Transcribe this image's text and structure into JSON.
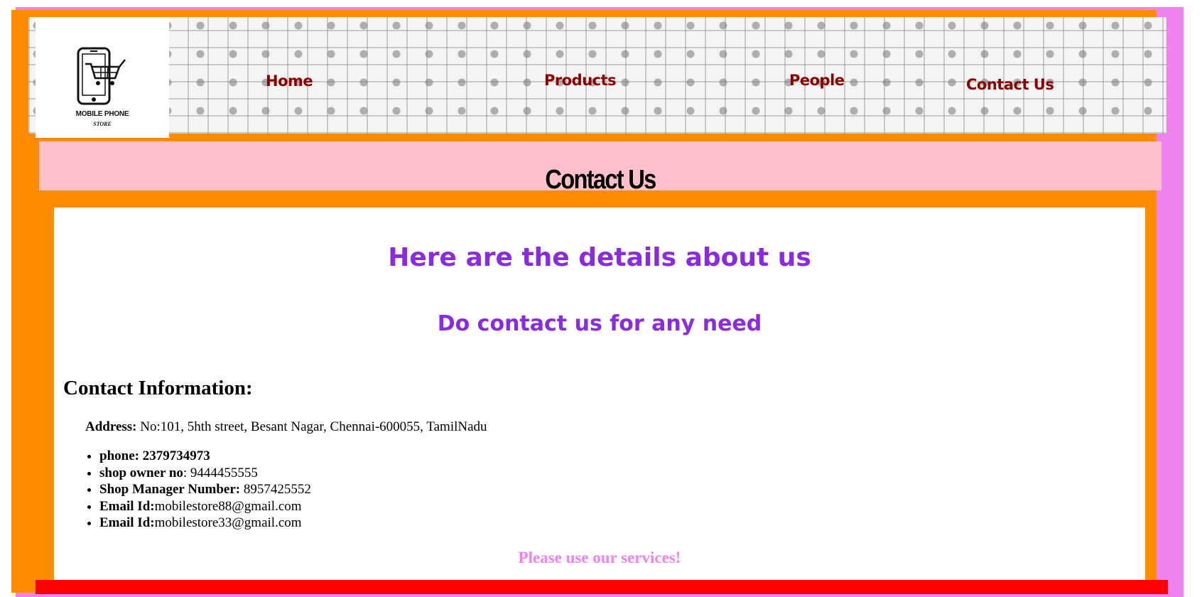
{
  "logo": {
    "line1": "MOBILE PHONE",
    "line2": "STORE"
  },
  "nav": {
    "home": "Home",
    "products": "Products",
    "people": "People",
    "contact": "Contact Us"
  },
  "title_bar": {
    "title": "Contact Us"
  },
  "main": {
    "heading": "Here are the details about us",
    "subheading": "Do contact us for any need",
    "section_title": "Contact Information:",
    "address": {
      "label": "Address:",
      "value": " No:101, 5hth street, Besant Nagar, Chennai-600055, TamilNadu"
    },
    "contacts": [
      {
        "label": "phone: 2379734973",
        "value": ""
      },
      {
        "label": "shop owner no",
        "value": ": 9444455555"
      },
      {
        "label": "Shop Manager Number:",
        "value": " 8957425552"
      },
      {
        "label": "Email Id:",
        "value": "mobilestore88@gmail.com"
      },
      {
        "label": "Email Id:",
        "value": "mobilestore33@gmail.com"
      }
    ],
    "footer_note": "Please use our services!"
  },
  "colors": {
    "outer_border": "#ee82ee",
    "frame": "#ff8c00",
    "title_bar": "#ffc0cb",
    "heading": "#8a2be2",
    "nav_link": "#8b0000",
    "footer_bar": "#ff0000"
  },
  "icons": {
    "logo": "phone-cart-icon"
  }
}
